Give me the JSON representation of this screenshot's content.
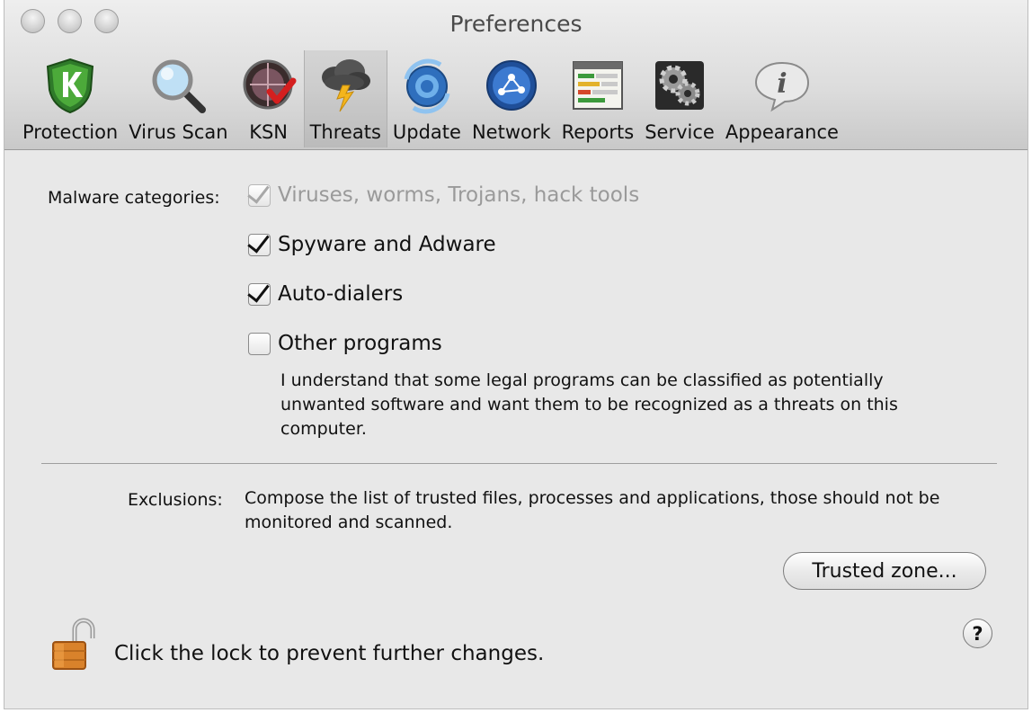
{
  "window": {
    "title": "Preferences"
  },
  "toolbar": [
    {
      "label": "Protection",
      "icon": "shield-k-icon"
    },
    {
      "label": "Virus Scan",
      "icon": "magnifier-icon"
    },
    {
      "label": "KSN",
      "icon": "ksn-globe-icon"
    },
    {
      "label": "Threats",
      "icon": "storm-cloud-icon"
    },
    {
      "label": "Update",
      "icon": "update-globe-icon"
    },
    {
      "label": "Network",
      "icon": "network-globe-icon"
    },
    {
      "label": "Reports",
      "icon": "report-table-icon"
    },
    {
      "label": "Service",
      "icon": "gears-icon"
    },
    {
      "label": "Appearance",
      "icon": "info-bubble-icon"
    }
  ],
  "active_tab": "Threats",
  "malware": {
    "label": "Malware categories:",
    "options": [
      {
        "label": "Viruses, worms, Trojans, hack tools",
        "checked": true,
        "disabled": true
      },
      {
        "label": "Spyware and Adware",
        "checked": true,
        "disabled": false
      },
      {
        "label": "Auto-dialers",
        "checked": true,
        "disabled": false
      },
      {
        "label": "Other programs",
        "checked": false,
        "disabled": false
      }
    ],
    "note_lines": [
      "I understand that some legal programs can be classified as potentially",
      "unwanted software and want them to be recognized as a threats on this",
      "computer."
    ]
  },
  "exclusions": {
    "label": "Exclusions:",
    "desc_lines": [
      "Compose the list of trusted files, processes and applications, those should not be",
      "monitored and scanned."
    ],
    "button_label": "Trusted zone..."
  },
  "help_label": "?",
  "lock_text": "Click the lock to prevent further changes."
}
